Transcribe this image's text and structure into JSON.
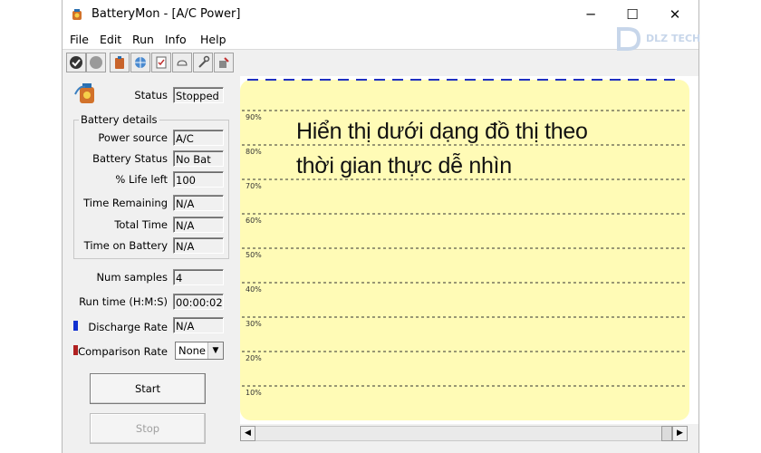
{
  "window": {
    "title": "BatteryMon - [A/C Power]",
    "minimize": "─",
    "maximize": "☐",
    "close": "✕"
  },
  "menu": [
    "File",
    "Edit",
    "Run",
    "Info",
    "Help"
  ],
  "toolbar": {
    "icons": [
      "check-icon",
      "stop-circle-icon",
      "battery-icon",
      "globe-icon",
      "checklist-icon",
      "cloud-icon",
      "tools-icon",
      "settings-icon"
    ]
  },
  "watermark": {
    "text": "DLZ TECH"
  },
  "status": {
    "label": "Status",
    "value": "Stopped"
  },
  "battery_details": {
    "title": "Battery details",
    "rows": [
      {
        "label": "Power source",
        "value": "A/C"
      },
      {
        "label": "Battery Status",
        "value": "No Bat"
      },
      {
        "label": "% Life left",
        "value": "100"
      },
      {
        "label": "Time Remaining",
        "value": "N/A"
      },
      {
        "label": "Total Time",
        "value": "N/A"
      },
      {
        "label": "Time on Battery",
        "value": "N/A"
      }
    ]
  },
  "stats": {
    "num_samples": {
      "label": "Num samples",
      "value": "4"
    },
    "run_time": {
      "label": "Run time (H:M:S)",
      "value": "00:00:02"
    },
    "discharge_rate": {
      "label": "Discharge Rate",
      "value": "N/A",
      "color": "#1030d0"
    },
    "comparison_rate": {
      "label": "Comparison Rate",
      "value": "None",
      "color": "#b02020"
    }
  },
  "buttons": {
    "start": "Start",
    "stop": "Stop"
  },
  "graph": {
    "background": "#fffbb6",
    "gridline_labels": [
      "90%",
      "80%",
      "70%",
      "60%",
      "50%",
      "40%",
      "30%",
      "20%",
      "10%"
    ],
    "overlay_line1": "Hiển thị dưới dạng đồ thị theo",
    "overlay_line2": "thời gian thực dễ nhìn"
  }
}
